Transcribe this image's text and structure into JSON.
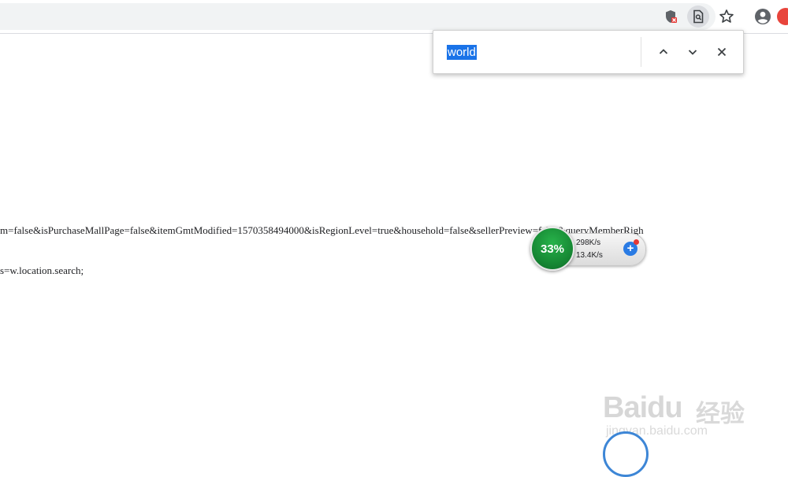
{
  "toolbar": {
    "icons": [
      "shield-icon",
      "find-in-page-icon",
      "star-icon",
      "account-icon",
      "extension-icon"
    ]
  },
  "find_bar": {
    "query": "world",
    "prev_icon": "chevron-up-icon",
    "next_icon": "chevron-down-icon",
    "close_icon": "close-icon"
  },
  "page": {
    "line1": "m=false&isPurchaseMallPage=false&itemGmtModified=1570358494000&isRegionLevel=true&household=false&sellerPreview=false&queryMemberRigh",
    "line2": "s=w.location.search;"
  },
  "net_monitor": {
    "percent": "33%",
    "upload": "298K/s",
    "download": "13.4K/s",
    "up_arrow": "↑",
    "down_arrow": "↓",
    "plus": "+"
  },
  "watermark": {
    "brand": "Baidu",
    "brand_cn": "经验",
    "url": "jingyan.baidu.com"
  },
  "colors": {
    "accent": "#1a73e8",
    "widget_green": "#178a35"
  }
}
